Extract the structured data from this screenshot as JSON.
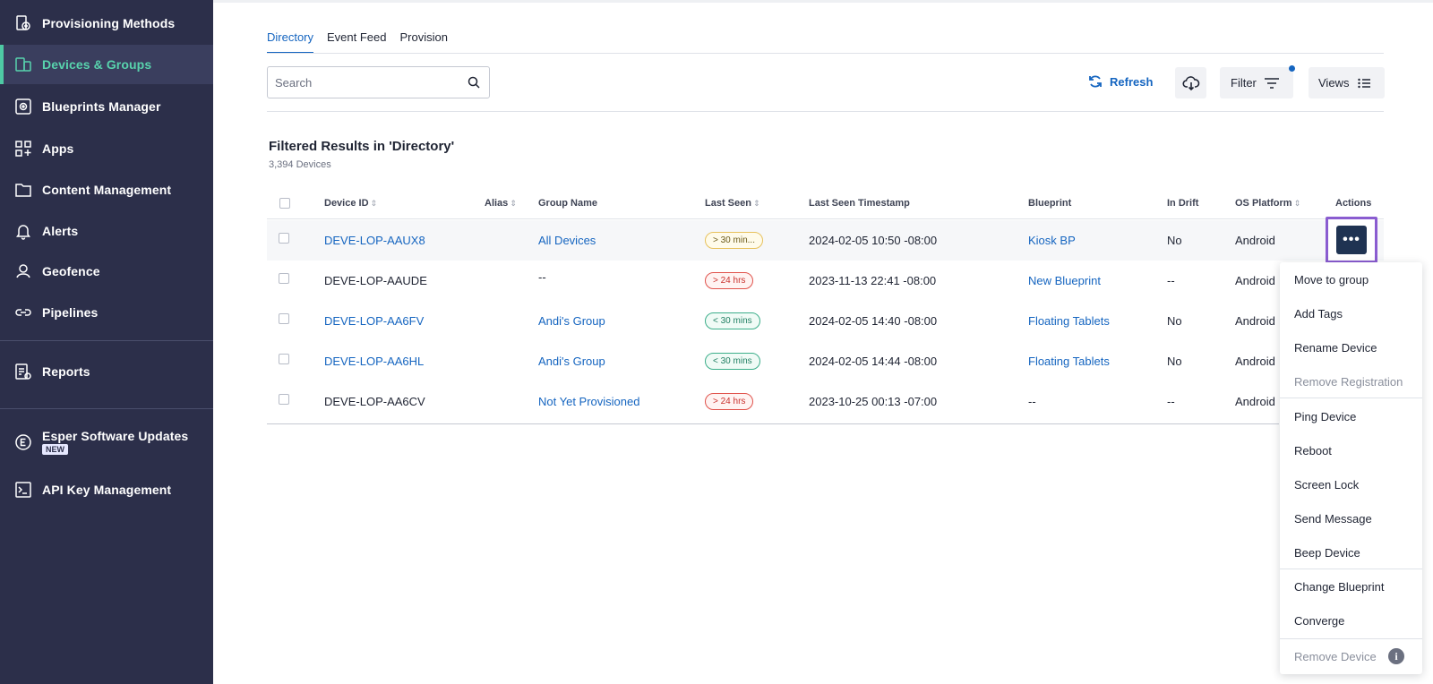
{
  "sidebar": {
    "items": [
      {
        "label": "Provisioning Methods",
        "icon": "provisioning-icon"
      },
      {
        "label": "Devices & Groups",
        "icon": "devices-icon"
      },
      {
        "label": "Blueprints Manager",
        "icon": "blueprint-icon"
      },
      {
        "label": "Apps",
        "icon": "apps-icon"
      },
      {
        "label": "Content Management",
        "icon": "folder-icon"
      },
      {
        "label": "Alerts",
        "icon": "bell-icon"
      },
      {
        "label": "Geofence",
        "icon": "geofence-icon"
      },
      {
        "label": "Pipelines",
        "icon": "pipelines-icon"
      },
      {
        "label": "Reports",
        "icon": "reports-icon"
      },
      {
        "label": "Esper Software Updates",
        "icon": "esper-icon",
        "badge": "NEW"
      },
      {
        "label": "API Key Management",
        "icon": "terminal-icon"
      }
    ],
    "active": "Devices & Groups"
  },
  "tabs": [
    "Directory",
    "Event Feed",
    "Provision"
  ],
  "active_tab": "Directory",
  "search": {
    "placeholder": "Search",
    "value": ""
  },
  "toolbar": {
    "refresh_label": "Refresh",
    "filter_label": "Filter",
    "views_label": "Views"
  },
  "results": {
    "title": "Filtered Results in 'Directory'",
    "count": "3,394 Devices"
  },
  "table": {
    "headers": {
      "device_id": "Device ID",
      "alias": "Alias",
      "group_name": "Group Name",
      "last_seen": "Last Seen",
      "timestamp": "Last Seen Timestamp",
      "blueprint": "Blueprint",
      "in_drift": "In Drift",
      "os_platform": "OS Platform",
      "actions": "Actions"
    },
    "rows": [
      {
        "device_id": "DEVE-LOP-AAUX8",
        "alias": "",
        "group": "All Devices",
        "last_seen": "> 30 min...",
        "status": "warn",
        "timestamp": "2024-02-05 10:50 -08:00",
        "blueprint": "Kiosk BP",
        "drift": "No",
        "os": "Android"
      },
      {
        "device_id": "DEVE-LOP-AAUDE",
        "alias": "",
        "group": "--",
        "last_seen": "> 24 hrs",
        "status": "bad",
        "timestamp": "2023-11-13 22:41 -08:00",
        "blueprint": "New Blueprint",
        "drift": "--",
        "os": "Android"
      },
      {
        "device_id": "DEVE-LOP-AA6FV",
        "alias": "",
        "group": "Andi's Group",
        "last_seen": "< 30 mins",
        "status": "good",
        "timestamp": "2024-02-05 14:40 -08:00",
        "blueprint": "Floating Tablets",
        "drift": "No",
        "os": "Android"
      },
      {
        "device_id": "DEVE-LOP-AA6HL",
        "alias": "",
        "group": "Andi's Group",
        "last_seen": "< 30 mins",
        "status": "good",
        "timestamp": "2024-02-05 14:44 -08:00",
        "blueprint": "Floating Tablets",
        "drift": "No",
        "os": "Android"
      },
      {
        "device_id": "DEVE-LOP-AA6CV",
        "alias": "",
        "group": "Not Yet Provisioned",
        "last_seen": "> 24 hrs",
        "status": "bad",
        "timestamp": "2023-10-25 00:13 -07:00",
        "blueprint": "--",
        "drift": "--",
        "os": "Android"
      }
    ]
  },
  "actions_menu": {
    "items": [
      {
        "label": "Move to group",
        "enabled": true
      },
      {
        "label": "Add Tags",
        "enabled": true
      },
      {
        "label": "Rename Device",
        "enabled": true
      },
      {
        "label": "Remove Registration",
        "enabled": false
      },
      {
        "label": "Ping Device",
        "enabled": true
      },
      {
        "label": "Reboot",
        "enabled": true
      },
      {
        "label": "Screen Lock",
        "enabled": true
      },
      {
        "label": "Send Message",
        "enabled": true
      },
      {
        "label": "Beep Device",
        "enabled": true
      },
      {
        "label": "Change Blueprint",
        "enabled": true
      },
      {
        "label": "Converge",
        "enabled": true
      },
      {
        "label": "Remove Device",
        "enabled": false
      }
    ]
  },
  "colors": {
    "sidebar_bg": "#2c2f4a",
    "active_accent": "#58d3ad",
    "link": "#1565c0",
    "highlight_border": "#8a5cd0"
  }
}
